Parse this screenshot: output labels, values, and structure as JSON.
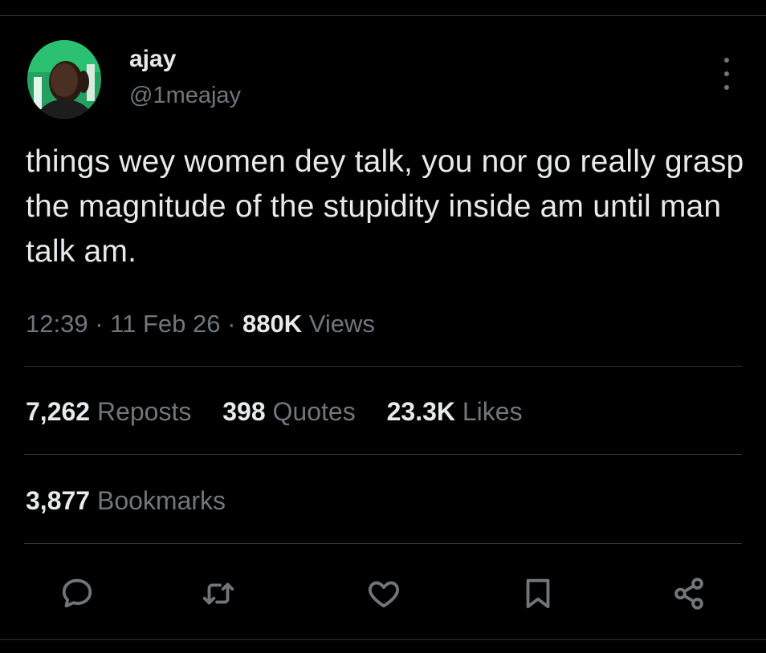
{
  "author": {
    "name": "ajay",
    "handle": "@1meajay",
    "avatar_icon": "profile-photo"
  },
  "tweet": {
    "text": "things wey women dey talk, you nor go really grasp the magnitude of the stupidity inside am until man talk am."
  },
  "meta": {
    "time": "12:39",
    "separator": "·",
    "date": "11 Feb 26",
    "views_count": "880K",
    "views_label": "Views"
  },
  "stats": [
    {
      "count": "7,262",
      "label": "Reposts"
    },
    {
      "count": "398",
      "label": "Quotes"
    },
    {
      "count": "23.3K",
      "label": "Likes"
    }
  ],
  "bookmarks": {
    "count": "3,877",
    "label": "Bookmarks"
  },
  "actions": [
    {
      "icon": "reply-icon"
    },
    {
      "icon": "repost-icon"
    },
    {
      "icon": "like-icon"
    },
    {
      "icon": "bookmark-icon"
    },
    {
      "icon": "share-icon"
    }
  ],
  "colors": {
    "background": "#000000",
    "text_primary": "#e7e9ea",
    "text_secondary": "#71767b",
    "divider": "#2f3336"
  }
}
